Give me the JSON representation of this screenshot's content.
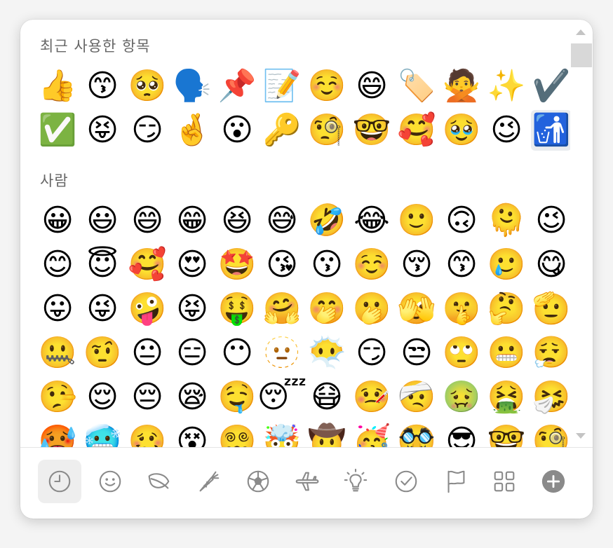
{
  "sections": [
    {
      "title": "최근 사용한 항목",
      "emojis": [
        "👍",
        "😙",
        "🥺",
        "🗣️",
        "📌",
        "📝",
        "☺️",
        "😄",
        "🏷️",
        "🙅",
        "✨",
        "✔️",
        "✅",
        "😝",
        "😏",
        "🤞",
        "😮",
        "🔑",
        "🧐",
        "🤓",
        "🥰",
        "🥹",
        "😉",
        "🚮"
      ],
      "selected_index": 23
    },
    {
      "title": "사람",
      "emojis": [
        "😀",
        "😃",
        "😄",
        "😁",
        "😆",
        "😅",
        "🤣",
        "😂",
        "🙂",
        "🙃",
        "🫠",
        "😉",
        "😊",
        "😇",
        "🥰",
        "😍",
        "🤩",
        "😘",
        "😗",
        "☺️",
        "😚",
        "😙",
        "🥲",
        "😋",
        "😛",
        "😜",
        "🤪",
        "😝",
        "🤑",
        "🤗",
        "🤭",
        "🫢",
        "🫣",
        "🤫",
        "🤔",
        "🫡",
        "🤐",
        "🤨",
        "😐",
        "😑",
        "😶",
        "🫥",
        "😶‍🌫️",
        "😏",
        "😒",
        "🙄",
        "😬",
        "😮‍💨",
        "🤥",
        "😌",
        "😔",
        "😪",
        "🤤",
        "😴",
        "😷",
        "🤒",
        "🤕",
        "🤢",
        "🤮",
        "🤧",
        "🥵",
        "🥶",
        "🥴",
        "😵",
        "😵‍💫",
        "🤯",
        "🤠",
        "🥳",
        "🥸",
        "😎",
        "🤓",
        "🧐"
      ]
    }
  ],
  "categories": [
    {
      "name": "recent",
      "icon": "clock-icon",
      "active": true
    },
    {
      "name": "people",
      "icon": "smiley-icon",
      "active": false
    },
    {
      "name": "nature",
      "icon": "leaf-icon",
      "active": false
    },
    {
      "name": "food",
      "icon": "carrot-icon",
      "active": false
    },
    {
      "name": "activity",
      "icon": "soccer-ball-icon",
      "active": false
    },
    {
      "name": "travel",
      "icon": "airplane-icon",
      "active": false
    },
    {
      "name": "objects",
      "icon": "lightbulb-icon",
      "active": false
    },
    {
      "name": "symbols",
      "icon": "check-circle-icon",
      "active": false
    },
    {
      "name": "flags",
      "icon": "flag-icon",
      "active": false
    },
    {
      "name": "custom",
      "icon": "grid-icon",
      "active": false
    },
    {
      "name": "add",
      "icon": "plus-circle-icon",
      "active": false
    }
  ],
  "colors": {
    "icon_gray": "#8a8a8a",
    "add_fill": "#8a8a8a",
    "selected_bg": "#e9ecef"
  }
}
